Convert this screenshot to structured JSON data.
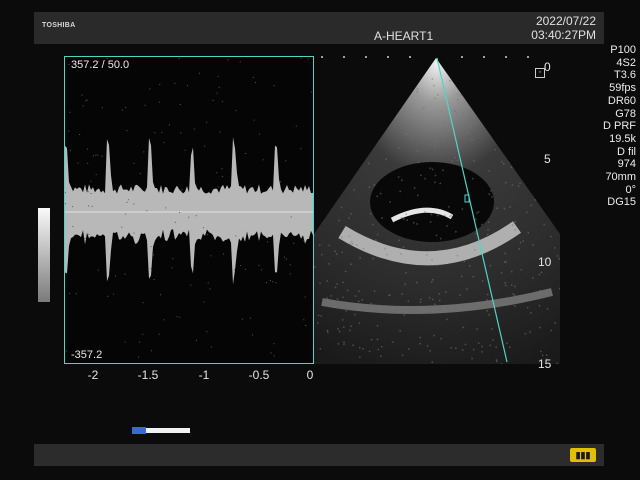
{
  "header": {
    "brand": "TOSHIBA",
    "preset": "A-HEART1",
    "date": "2022/07/22",
    "time": "03:40:27PM"
  },
  "doppler": {
    "max_label": "357.2 / 50.0",
    "min_label": "-357.2",
    "time_ticks": [
      "-2",
      "-1.5",
      "-1",
      "-0.5",
      "0"
    ]
  },
  "depth_scale": [
    "0",
    "5",
    "10",
    "15"
  ],
  "parameters": [
    "P100",
    "4S2",
    "T3.6",
    "59fps",
    "DR60",
    "G78",
    "D PRF",
    "19.5k",
    "D fil",
    "974",
    "70mm",
    "0°",
    "DG15"
  ],
  "colors": {
    "frame_accent": "#4fd4c8",
    "cine_button": "#e0c000",
    "cine_indicator": "#3a6ad0"
  },
  "icons": {
    "mode": "pulse-wave-doppler-icon",
    "cine": "cine-loop-icon"
  }
}
